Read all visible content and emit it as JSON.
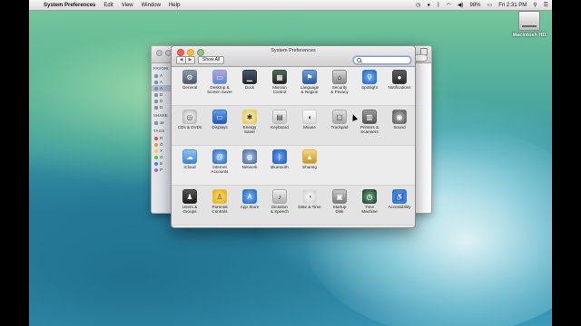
{
  "menubar": {
    "apple": "",
    "app_name": "System Preferences",
    "items": [
      "Edit",
      "View",
      "Window",
      "Help"
    ],
    "battery": "98%",
    "clock": "Fri 2:31 PM"
  },
  "desktop": {
    "drive_label": "Macintosh HD"
  },
  "finder": {
    "sidebar_favorites": "FAVORI",
    "sidebar_shared": "SHARE",
    "sidebar_tags": "TAGS",
    "favorites": [
      "A",
      "A",
      "A",
      "D",
      "D",
      "D"
    ],
    "shared": [
      "Je"
    ],
    "tags": [
      "R",
      "O",
      "Y",
      "G",
      "B",
      "P"
    ],
    "tag_colors": [
      "#f2453d",
      "#f7982b",
      "#f7d33b",
      "#59c24c",
      "#3c89f0",
      "#b460d6"
    ]
  },
  "window": {
    "title": "System Preferences",
    "back": "◀",
    "forward": "▶",
    "show_all": "Show All",
    "search_placeholder": ""
  },
  "sections": [
    [
      {
        "id": "general",
        "icon": "general-icon",
        "lines": [
          "General"
        ]
      },
      {
        "id": "desktop",
        "icon": "desktop-screensaver-icon",
        "lines": [
          "Desktop &",
          "Screen Saver"
        ]
      },
      {
        "id": "dock",
        "icon": "dock-icon",
        "lines": [
          "Dock"
        ]
      },
      {
        "id": "mission",
        "icon": "mission-control-icon",
        "lines": [
          "Mission",
          "Control"
        ]
      },
      {
        "id": "language",
        "icon": "language-region-icon",
        "lines": [
          "Language",
          "& Region"
        ]
      },
      {
        "id": "security",
        "icon": "security-privacy-icon",
        "lines": [
          "Security",
          "& Privacy"
        ]
      },
      {
        "id": "spotlight",
        "icon": "spotlight-icon",
        "lines": [
          "Spotlight"
        ]
      },
      {
        "id": "notifications",
        "icon": "notifications-icon",
        "lines": [
          "Notifications"
        ]
      }
    ],
    [
      {
        "id": "cds",
        "icon": "cds-dvds-icon",
        "lines": [
          "CDs & DVDs"
        ]
      },
      {
        "id": "displays",
        "icon": "displays-icon",
        "lines": [
          "Displays"
        ]
      },
      {
        "id": "energy",
        "icon": "energy-saver-icon",
        "lines": [
          "Energy",
          "Saver"
        ]
      },
      {
        "id": "keyboard",
        "icon": "keyboard-icon",
        "lines": [
          "Keyboard"
        ]
      },
      {
        "id": "mouse",
        "icon": "mouse-icon",
        "lines": [
          "Mouse"
        ]
      },
      {
        "id": "trackpad",
        "icon": "trackpad-icon",
        "lines": [
          "Trackpad"
        ]
      },
      {
        "id": "printers",
        "icon": "printers-scanners-icon",
        "lines": [
          "Printers &",
          "Scanners"
        ]
      },
      {
        "id": "sound",
        "icon": "sound-icon",
        "lines": [
          "Sound"
        ]
      }
    ],
    [
      {
        "id": "icloud",
        "icon": "icloud-icon",
        "lines": [
          "iCloud"
        ]
      },
      {
        "id": "internet",
        "icon": "internet-accounts-icon",
        "lines": [
          "Internet",
          "Accounts"
        ]
      },
      {
        "id": "network",
        "icon": "network-icon",
        "lines": [
          "Network"
        ]
      },
      {
        "id": "bluetooth",
        "icon": "bluetooth-icon",
        "lines": [
          "Bluetooth"
        ]
      },
      {
        "id": "sharing",
        "icon": "sharing-icon",
        "lines": [
          "Sharing"
        ]
      }
    ],
    [
      {
        "id": "users",
        "icon": "users-groups-icon",
        "lines": [
          "Users &",
          "Groups"
        ]
      },
      {
        "id": "parental",
        "icon": "parental-controls-icon",
        "lines": [
          "Parental",
          "Controls"
        ]
      },
      {
        "id": "appstore",
        "icon": "app-store-icon",
        "lines": [
          "App Store"
        ]
      },
      {
        "id": "dictation",
        "icon": "dictation-speech-icon",
        "lines": [
          "Dictation",
          "& Speech"
        ]
      },
      {
        "id": "datetime",
        "icon": "date-time-icon",
        "lines": [
          "Date & Time"
        ]
      },
      {
        "id": "startup",
        "icon": "startup-disk-icon",
        "lines": [
          "Startup",
          "Disk"
        ]
      },
      {
        "id": "timemachine",
        "icon": "time-machine-icon",
        "lines": [
          "Time",
          "Machine"
        ]
      },
      {
        "id": "accessibility",
        "icon": "accessibility-icon",
        "lines": [
          "Accessibility"
        ]
      }
    ]
  ]
}
